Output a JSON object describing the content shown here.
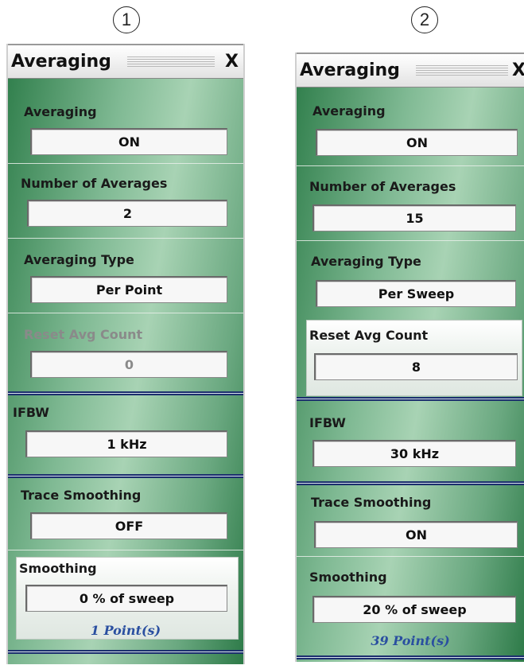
{
  "callouts": [
    "1",
    "2"
  ],
  "panels": [
    {
      "title": "Averaging",
      "close": "X",
      "averaging_label": "Averaging",
      "averaging_value": "ON",
      "num_avg_label": "Number of Averages",
      "num_avg_value": "2",
      "avg_type_label": "Averaging Type",
      "avg_type_value": "Per Point",
      "reset_label": "Reset Avg Count",
      "reset_value": "0",
      "ifbw_label": "IFBW",
      "ifbw_value": "1 kHz",
      "trace_smoothing_label": "Trace Smoothing",
      "trace_smoothing_value": "OFF",
      "smoothing_label": "Smoothing",
      "smoothing_value": "0  % of sweep",
      "points": "1 Point(s)"
    },
    {
      "title": "Averaging",
      "close": "X",
      "averaging_label": "Averaging",
      "averaging_value": "ON",
      "num_avg_label": "Number of Averages",
      "num_avg_value": "15",
      "avg_type_label": "Averaging Type",
      "avg_type_value": "Per Sweep",
      "reset_label": "Reset Avg Count",
      "reset_value": "8",
      "ifbw_label": "IFBW",
      "ifbw_value": "30 kHz",
      "trace_smoothing_label": "Trace Smoothing",
      "trace_smoothing_value": "ON",
      "smoothing_label": "Smoothing",
      "smoothing_value": "20  % of sweep",
      "points": "39 Point(s)"
    }
  ]
}
